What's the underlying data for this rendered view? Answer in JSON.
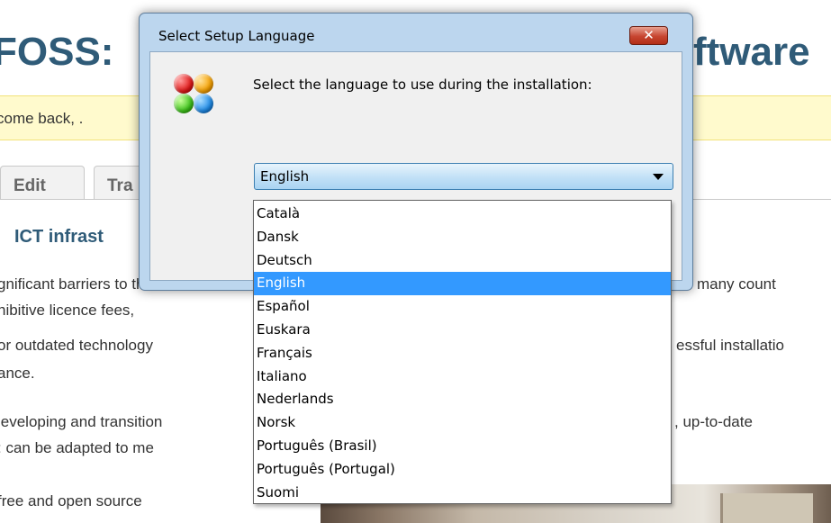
{
  "page": {
    "title_left": "FOSS:",
    "title_right": "ftware",
    "welcome": "come back, .",
    "tabs": [
      {
        "label": "Edit"
      },
      {
        "label": "Tra"
      }
    ],
    "section_heading": "ICT infrast",
    "body_lines": [
      {
        "left": "gnificant barriers to the",
        "right": "in many count"
      },
      {
        "left": "hibitive licence fees,",
        "right": ""
      },
      {
        "left": "or outdated technology",
        "right": "essful installatio"
      },
      {
        "left": "ance.",
        "right": ""
      },
      {
        "left": "leveloping and transition",
        "right": ", up-to-date"
      },
      {
        "left": ": can be adapted to me",
        "right": ""
      },
      {
        "left": "free and open source",
        "right": ""
      }
    ]
  },
  "dialog": {
    "title": "Select Setup Language",
    "close_label": "✕",
    "prompt": "Select the language to use during the installation:",
    "icon": "setup-language-icon",
    "selected_language": "English",
    "languages": [
      "Català",
      "Dansk",
      "Deutsch",
      "English",
      "Español",
      "Euskara",
      "Français",
      "Italiano",
      "Nederlands",
      "Norsk",
      "Português (Brasil)",
      "Português (Portugal)",
      "Suomi"
    ],
    "highlighted_index": 3
  },
  "colors": {
    "highlight": "#3399ff",
    "dialog_frame": "#bcd6ee",
    "site_title": "#2f5b78",
    "welcome_bar": "#fffacd"
  }
}
